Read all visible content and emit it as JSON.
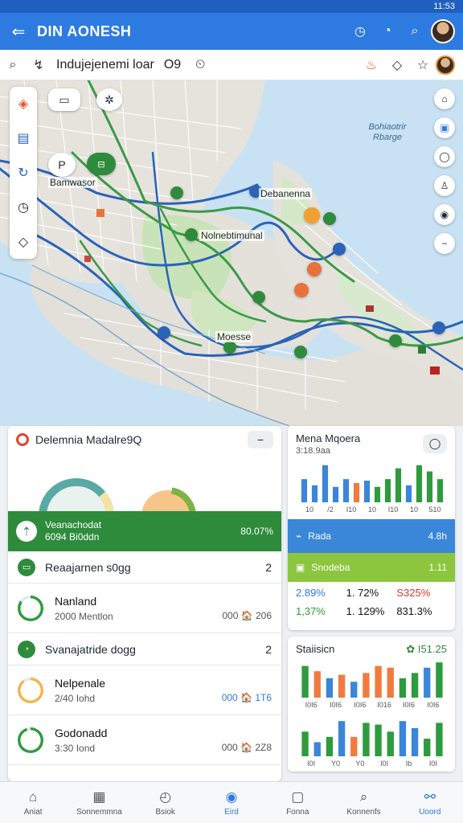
{
  "status": {
    "time": "11:53"
  },
  "appbar": {
    "title": "DIN AONESH"
  },
  "search": {
    "text": "Indujejenemi loar",
    "suffix": "O9"
  },
  "map": {
    "labels": [
      "Bamwasor",
      "Debanenna",
      "Nolnebtimunal",
      "Moesse"
    ],
    "water_label": "Bohiaotrir Rbarge",
    "pin_glyph": "P"
  },
  "left_panel": {
    "title": "Delemnia Madalre9Q",
    "highlight": {
      "line1": "Veanachodat",
      "line2": "6094 Bi0ddn",
      "value": "80.07%"
    },
    "groups": [
      {
        "header": "Reaajarnen s0gg",
        "count": "2",
        "items": [
          {
            "title": "Nanland",
            "subtitle": "2000 Mentlon",
            "meta": "000 🏠 206",
            "ring_color": "#2e9b3e",
            "ring_pct": 0.85
          }
        ]
      },
      {
        "header": "Svanajatride dogg",
        "count": "2",
        "items": [
          {
            "title": "Nelpenale",
            "subtitle": "2/40 Iohd",
            "meta": "000 🏠 1T6",
            "ring_color": "#f4b34a",
            "ring_pct": 0.9
          },
          {
            "title": "Godonadd",
            "subtitle": "3:30 Iond",
            "meta": "000 🏠 2Z8",
            "ring_color": "#2e9b3e",
            "ring_pct": 0.95
          }
        ]
      }
    ],
    "donut_colors": [
      "#5aa9a4",
      "#f5c66a"
    ]
  },
  "right_panel_1": {
    "title": "Mena Mqoera",
    "subtitle": "3:18.9aa",
    "chart_data": {
      "type": "bar",
      "categories": [
        "10",
        "/2",
        "I10",
        "10",
        "I10",
        "10",
        "510"
      ],
      "series": [
        {
          "values": [
            30,
            22,
            48,
            20,
            30,
            25,
            28,
            20,
            30,
            44,
            22,
            48,
            40,
            30
          ]
        }
      ],
      "colors": [
        "#3a86d9",
        "#3a86d9",
        "#3a86d9",
        "#3a86d9",
        "#3a86d9",
        "#f07b3f",
        "#3a86d9",
        "#2e9b3e",
        "#2e9b3e",
        "#2e9b3e",
        "#3a86d9",
        "#2e9b3e",
        "#2e9b3e",
        "#2e9b3e"
      ]
    },
    "blue_bar": {
      "label": "Rada",
      "value": "4.8h"
    },
    "lime_bar": {
      "label": "Snodeba",
      "value": "1.11"
    },
    "stats": [
      "2.89%",
      "1. 72%",
      "S325%",
      "1,37%",
      "1. 129%",
      "831.3%"
    ],
    "stat_colors": [
      "#2d7be0",
      "#111",
      "#d83a2a",
      "#2e9b3e",
      "#111",
      "#111"
    ]
  },
  "right_panel_2": {
    "title": "Staiisicn",
    "badge": "✿ I51.25",
    "chart_data": [
      {
        "type": "bar",
        "categories": [
          "I0I6",
          "I0I6",
          "I0I6",
          "I016",
          "I0I6",
          "I0I6"
        ],
        "values": [
          36,
          30,
          22,
          26,
          18,
          28,
          36,
          34,
          22,
          28,
          34,
          40
        ],
        "colors": [
          "#2e9b3e",
          "#f07b3f",
          "#3a86d9",
          "#f07b3f",
          "#3a86d9",
          "#f07b3f",
          "#f07b3f",
          "#f07b3f",
          "#2e9b3e",
          "#2e9b3e",
          "#3a86d9",
          "#2e9b3e"
        ]
      },
      {
        "type": "bar",
        "categories": [
          "I0I",
          "Y0",
          "Y0",
          "I0I",
          "Ib",
          "I0I"
        ],
        "values": [
          28,
          16,
          22,
          40,
          22,
          38,
          36,
          28,
          40,
          32,
          20,
          38
        ],
        "colors": [
          "#2e9b3e",
          "#3a86d9",
          "#2e9b3e",
          "#3a86d9",
          "#f07b3f",
          "#2e9b3e",
          "#2e9b3e",
          "#2e9b3e",
          "#3a86d9",
          "#3a86d9",
          "#2e9b3e",
          "#2e9b3e"
        ]
      }
    ]
  },
  "bottom_nav": [
    {
      "label": "Aniat",
      "icon": "⌂"
    },
    {
      "label": "Sonnemmna",
      "icon": "▦"
    },
    {
      "label": "Bsiok",
      "icon": "◴"
    },
    {
      "label": "Eird",
      "icon": "◉",
      "active": true
    },
    {
      "label": "Fonna",
      "icon": "▢"
    },
    {
      "label": "Konnenfs",
      "icon": "⌕"
    },
    {
      "label": "Uoord",
      "icon": "⚯",
      "active": true
    }
  ]
}
